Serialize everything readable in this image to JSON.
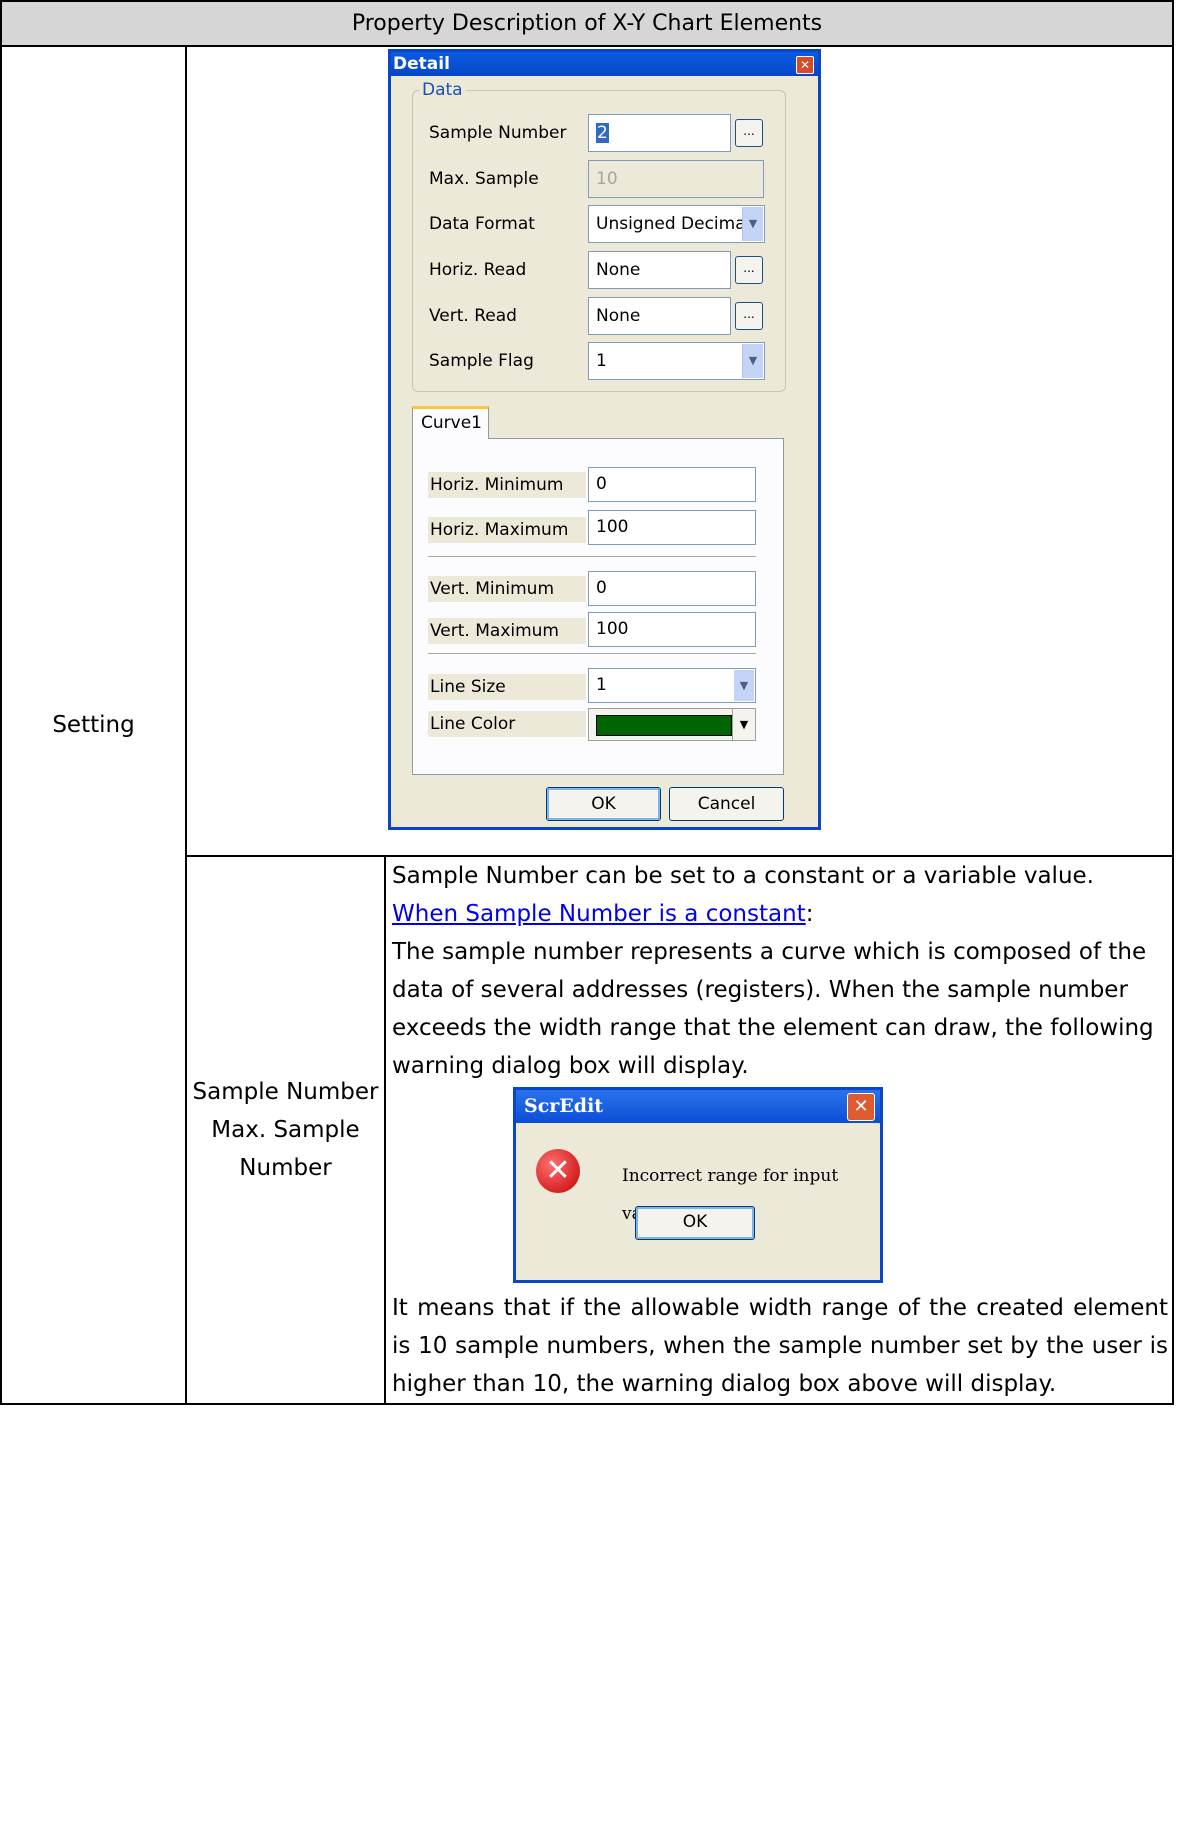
{
  "header": {
    "title": "Property Description of X-Y Chart Elements"
  },
  "setting_row": {
    "label": "Setting"
  },
  "detail_dialog": {
    "title": "Detail",
    "data_group": {
      "title": "Data",
      "sample_number_label": "Sample Number",
      "sample_number_value": "2",
      "ellipsis": "...",
      "max_sample_label": "Max. Sample",
      "max_sample_value": "10",
      "data_format_label": "Data Format",
      "data_format_value": "Unsigned Decima",
      "horiz_read_label": "Horiz. Read",
      "horiz_read_value": "None",
      "vert_read_label": "Vert. Read",
      "vert_read_value": "None",
      "sample_flag_label": "Sample Flag",
      "sample_flag_value": "1"
    },
    "tab": {
      "label": "Curve1",
      "horiz_min_label": "Horiz. Minimum",
      "horiz_min_value": "0",
      "horiz_max_label": "Horiz. Maximum",
      "horiz_max_value": "100",
      "vert_min_label": "Vert. Minimum",
      "vert_min_value": "0",
      "vert_max_label": "Vert. Maximum",
      "vert_max_value": "100",
      "line_size_label": "Line Size",
      "line_size_value": "1",
      "line_color_label": "Line Color",
      "line_color": "#006400"
    },
    "ok_label": "OK",
    "cancel_label": "Cancel"
  },
  "sample_row": {
    "label_line1": "Sample Number",
    "label_line2": "Max. Sample",
    "label_line3": "Number",
    "para1": "Sample Number can be set to a constant or a variable value.",
    "link": "When Sample Number is a constant",
    "link_suffix": ":",
    "para2": "The sample number represents a curve which is composed of the data of several addresses (registers). When the sample number exceeds the width range that the element can draw, the following warning dialog box will display.",
    "para3": "It means that if the allowable width range of the created element is 10 sample numbers, when the sample number set by the user is higher than 10, the warning dialog box above will display."
  },
  "error_dialog": {
    "title": "ScrEdit",
    "message": "Incorrect range for input value",
    "ok_label": "OK"
  }
}
